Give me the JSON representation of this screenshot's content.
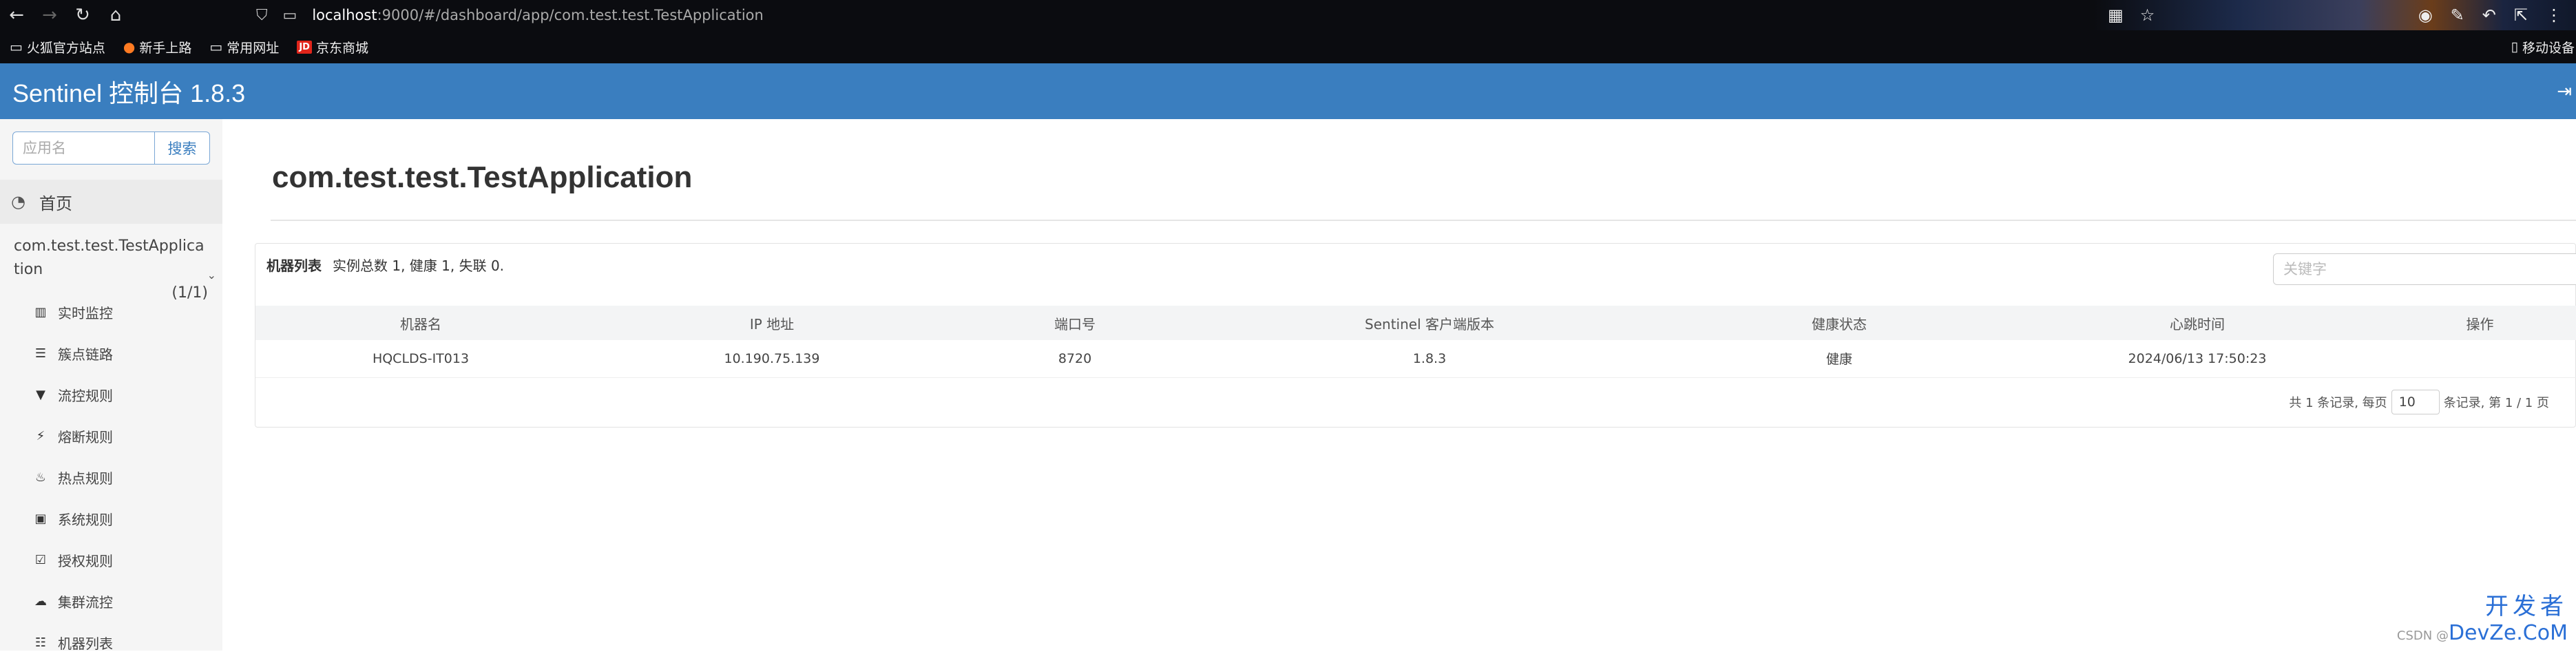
{
  "browser": {
    "url_host": "localhost",
    "url_rest": ":9000/#/dashboard/app/com.test.test.TestApplication",
    "bookmarks": [
      "火狐官方站点",
      "新手上路",
      "常用网址",
      "京东商城"
    ],
    "mobile_bookmarks": "移动设备"
  },
  "header": {
    "title": "Sentinel 控制台 1.8.3"
  },
  "sidebar": {
    "search_placeholder": "应用名",
    "search_button": "搜索",
    "home_label": "首页",
    "app_name": "com.test.test.TestApplication",
    "app_count": "(1/1)",
    "menu": [
      {
        "label": "实时监控",
        "icon": "chart-icon"
      },
      {
        "label": "簇点链路",
        "icon": "list-icon"
      },
      {
        "label": "流控规则",
        "icon": "filter-icon"
      },
      {
        "label": "熔断规则",
        "icon": "bolt-icon"
      },
      {
        "label": "热点规则",
        "icon": "fire-icon"
      },
      {
        "label": "系统规则",
        "icon": "lock-icon"
      },
      {
        "label": "授权规则",
        "icon": "check-icon"
      },
      {
        "label": "集群流控",
        "icon": "cloud-icon"
      },
      {
        "label": "机器列表",
        "icon": "list-icon"
      }
    ]
  },
  "main": {
    "page_title": "com.test.test.TestApplication",
    "panel_title": "机器列表",
    "panel_summary": "实例总数 1, 健康 1, 失联 0.",
    "keyword_placeholder": "关键字",
    "columns": [
      "机器名",
      "IP 地址",
      "端口号",
      "Sentinel 客户端版本",
      "健康状态",
      "心跳时间",
      "操作"
    ],
    "rows": [
      [
        "HQCLDS-IT013",
        "10.190.75.139",
        "8720",
        "1.8.3",
        "健康",
        "2024/06/13 17:50:23",
        ""
      ]
    ],
    "pager": {
      "prefix": "共 1 条记录, 每页",
      "page_size": "10",
      "suffix": "条记录, 第 1 / 1 页"
    }
  },
  "watermark": {
    "big": "开发者",
    "small": "CSDN @",
    "brand": "DevZe.CoM"
  }
}
